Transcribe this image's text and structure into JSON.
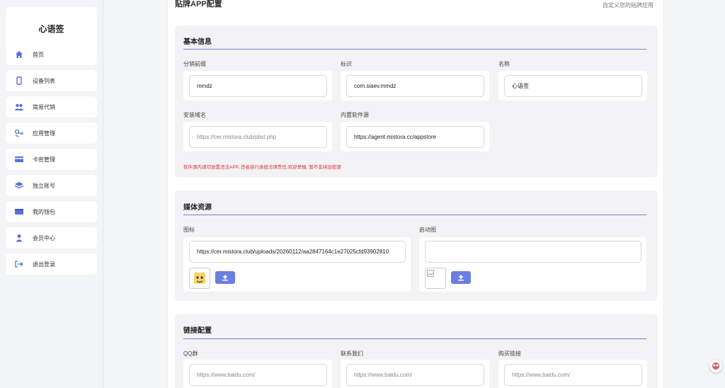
{
  "sidebar": {
    "brand": "心语签",
    "items": [
      {
        "label": "首页",
        "icon": "home-icon"
      },
      {
        "label": "设备列表",
        "icon": "device-icon"
      },
      {
        "label": "简易代销",
        "icon": "users-icon"
      },
      {
        "label": "应用管理",
        "icon": "app-icon"
      },
      {
        "label": "卡密管理",
        "icon": "card-icon"
      },
      {
        "label": "独立账号",
        "icon": "layers-icon"
      },
      {
        "label": "我的钱包",
        "icon": "wallet-icon"
      },
      {
        "label": "会员中心",
        "icon": "user-icon"
      },
      {
        "label": "退出登录",
        "icon": "logout-icon"
      }
    ]
  },
  "header": {
    "title": "贴牌APP配置",
    "subtitle": "自定义您的贴牌应用"
  },
  "basic": {
    "title": "基本信息",
    "prefix_label": "分销前缀",
    "prefix_value": "mmdz",
    "id_label": "标识",
    "id_value": "com.siaev.mmdz",
    "name_label": "名称",
    "name_value": "心语签",
    "domain_label": "安装域名",
    "domain_placeholder": "https://cer.mistora.club/plist.php",
    "source_label": "内置软件源",
    "source_value": "https://agent.mistora.cc/appstore",
    "warning": "软件源内请勿放置违法APP, 违者自行承担法律责任,欢迎举报, 暂不支持加密源"
  },
  "media": {
    "title": "媒体资源",
    "icon_label": "图标",
    "icon_value": "https://cer.mistora.club/uploads/20260112/aa2847164c1e27025cfd93902810",
    "splash_label": "启动图",
    "splash_value": ""
  },
  "links": {
    "title": "链接配置",
    "qq_label": "QQ群",
    "qq_placeholder": "https://www.baidu.com/",
    "contact_label": "联系我们",
    "contact_placeholder": "https://www.baidu.com/",
    "buy_label": "购买链接",
    "buy_placeholder": "https://www.baidu.com/"
  },
  "colors": {
    "accent": "#6a7fe0",
    "warning": "#dd3333"
  }
}
